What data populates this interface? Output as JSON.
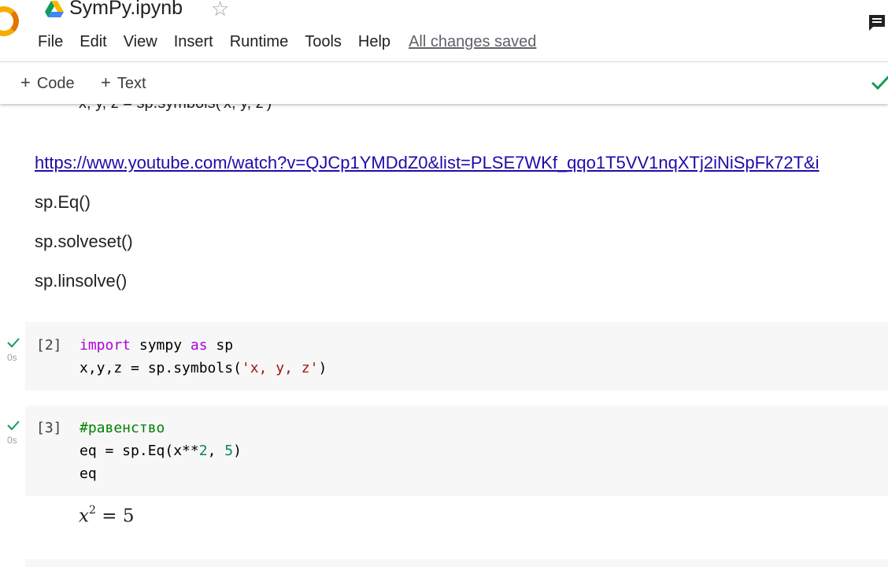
{
  "header": {
    "title": "SymPy.ipynb",
    "menu": [
      "File",
      "Edit",
      "View",
      "Insert",
      "Runtime",
      "Tools",
      "Help"
    ],
    "save_status": "All changes saved"
  },
  "toolbar": {
    "add_code_label": "Code",
    "add_text_label": "Text"
  },
  "notebook": {
    "cut_off_text": "x, y, z = sp.symbols('x, y, z')",
    "markdown": {
      "link": "https://www.youtube.com/watch?v=QJCp1YMDdZ0&list=PLSE7WKf_qqo1T5VV1nqXTj2iNiSpFk72T&i",
      "lines": [
        "sp.Eq()",
        "sp.solveset()",
        "sp.linsolve()"
      ]
    },
    "cells": [
      {
        "exec_count": "[2]",
        "exec_time": "0s",
        "code": {
          "l1_kw1": "import",
          "l1_mid": " sympy ",
          "l1_kw2": "as",
          "l1_end": " sp",
          "l2_pre": "x,y,z = sp.symbols(",
          "l2_str": "'x, y, z'",
          "l2_post": ")"
        }
      },
      {
        "exec_count": "[3]",
        "exec_time": "0s",
        "code": {
          "l1_comment": "#равенство",
          "l2_pre": "eq = sp.Eq(x**",
          "l2_num1": "2",
          "l2_mid": ", ",
          "l2_num2": "5",
          "l2_post": ")",
          "l3": "eq"
        },
        "output": {
          "base": "x",
          "exponent": "2",
          "equals": "=",
          "rhs": "5"
        }
      }
    ]
  },
  "colors": {
    "accent_green": "#0f9d58",
    "link": "#1a0dab",
    "cell_bg": "#f7f7f7",
    "keyword": "#af00db",
    "string": "#a31515",
    "number": "#098658",
    "comment": "#008000"
  },
  "icons": {
    "logo": "colab-logo",
    "drive": "google-drive-icon",
    "star": "star-icon",
    "comment": "comment-icon",
    "connected": "check-icon"
  }
}
